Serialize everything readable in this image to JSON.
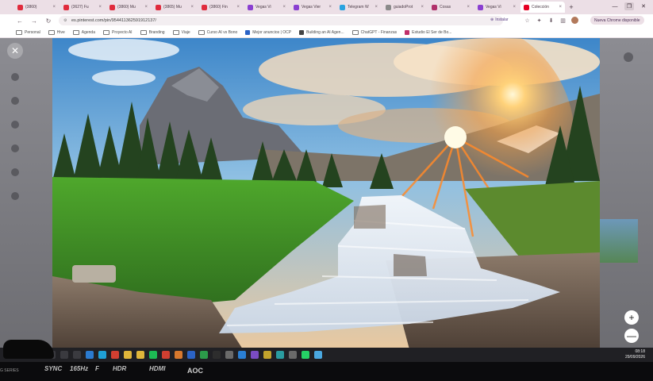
{
  "browser": {
    "tabs": [
      {
        "label": "(3860)",
        "color": "#e02b3c",
        "active": false
      },
      {
        "label": "(3627) Fu",
        "color": "#e02b3c",
        "active": false
      },
      {
        "label": "(3860) Mu",
        "color": "#e02b3c",
        "active": false
      },
      {
        "label": "(3865) Mu",
        "color": "#e02b3c",
        "active": false
      },
      {
        "label": "(3860) Fin",
        "color": "#e02b3c",
        "active": false
      },
      {
        "label": "Vegas Vi",
        "color": "#8a3fd1",
        "active": false
      },
      {
        "label": "Vegas Vier",
        "color": "#8a3fd1",
        "active": false
      },
      {
        "label": "Telegram W",
        "color": "#2aa3e0",
        "active": false
      },
      {
        "label": "guiadoProt",
        "color": "#8a8a8a",
        "active": false
      },
      {
        "label": "Cosas",
        "color": "#b0306a",
        "active": false
      },
      {
        "label": "Vegas Vi",
        "color": "#8a3fd1",
        "active": false
      },
      {
        "label": "Colección",
        "color": "#e60023",
        "active": true
      }
    ],
    "new_tab": "+",
    "window_controls": [
      "—",
      "❐",
      "✕"
    ],
    "nav": {
      "back": "←",
      "forward": "→",
      "reload": "↻"
    },
    "address": "es.pinterest.com/pin/954411362591912137/",
    "install_label": "Instalar",
    "new_chrome_label": "Nueva Chrome disponible",
    "bookmarks": [
      {
        "label": "Personal",
        "type": "folder"
      },
      {
        "label": "Hive",
        "type": "folder"
      },
      {
        "label": "Agenda",
        "type": "folder"
      },
      {
        "label": "Proyecto AI",
        "type": "folder"
      },
      {
        "label": "Branding",
        "type": "folder"
      },
      {
        "label": "Viaje",
        "type": "folder"
      },
      {
        "label": "Curso AI vs Bono",
        "type": "folder"
      },
      {
        "label": "Mejor anuncios | OCP",
        "type": "link",
        "color": "#2b63c6"
      },
      {
        "label": "Building an AI Agen...",
        "type": "link",
        "color": "#444"
      },
      {
        "label": "ChatGPT - Finanzas",
        "type": "folder"
      },
      {
        "label": "Estudio El Ser de Bo...",
        "type": "link",
        "color": "#c0306a"
      }
    ]
  },
  "viewer": {
    "close_icon": "✕",
    "zoom_in": "+",
    "zoom_out": "—"
  },
  "taskbar": {
    "time": "08:18",
    "date": "29/09/2026",
    "icons": [
      {
        "name": "start-icon",
        "color": "#3a3a3f"
      },
      {
        "name": "search-icon",
        "color": "#3a3a3f"
      },
      {
        "name": "taskview-icon",
        "color": "#3a3a3f"
      },
      {
        "name": "photos-icon",
        "color": "#2b7bd0"
      },
      {
        "name": "edge-icon",
        "color": "#1fa0d6"
      },
      {
        "name": "chrome-icon",
        "color": "#d23f31"
      },
      {
        "name": "files-icon",
        "color": "#e0b63a"
      },
      {
        "name": "folder-icon",
        "color": "#e0b63a"
      },
      {
        "name": "spotify-icon",
        "color": "#1db954"
      },
      {
        "name": "app-red-icon",
        "color": "#d23f31"
      },
      {
        "name": "app-orange-icon",
        "color": "#d7782d"
      },
      {
        "name": "app-blue-icon",
        "color": "#2b63c6"
      },
      {
        "name": "app-green-icon",
        "color": "#2c9b4a"
      },
      {
        "name": "terminal-icon",
        "color": "#2d2d2d"
      },
      {
        "name": "app-gray-icon",
        "color": "#6a6a6a"
      },
      {
        "name": "vscode-icon",
        "color": "#2a7fd4"
      },
      {
        "name": "app-purple-icon",
        "color": "#7a4cc2"
      },
      {
        "name": "app-yellow-icon",
        "color": "#c2a32c"
      },
      {
        "name": "app-teal-icon",
        "color": "#2a9ca0"
      },
      {
        "name": "clock-icon",
        "color": "#6a6a6a"
      },
      {
        "name": "whatsapp-icon",
        "color": "#25d366"
      },
      {
        "name": "app-lightblue-icon",
        "color": "#4aa8e0"
      }
    ]
  },
  "monitor": {
    "brand": "AOC",
    "stickers": [
      "SYNC",
      "165Hz",
      "F",
      "HDR",
      "HDMI"
    ],
    "series": "G SERIES"
  }
}
